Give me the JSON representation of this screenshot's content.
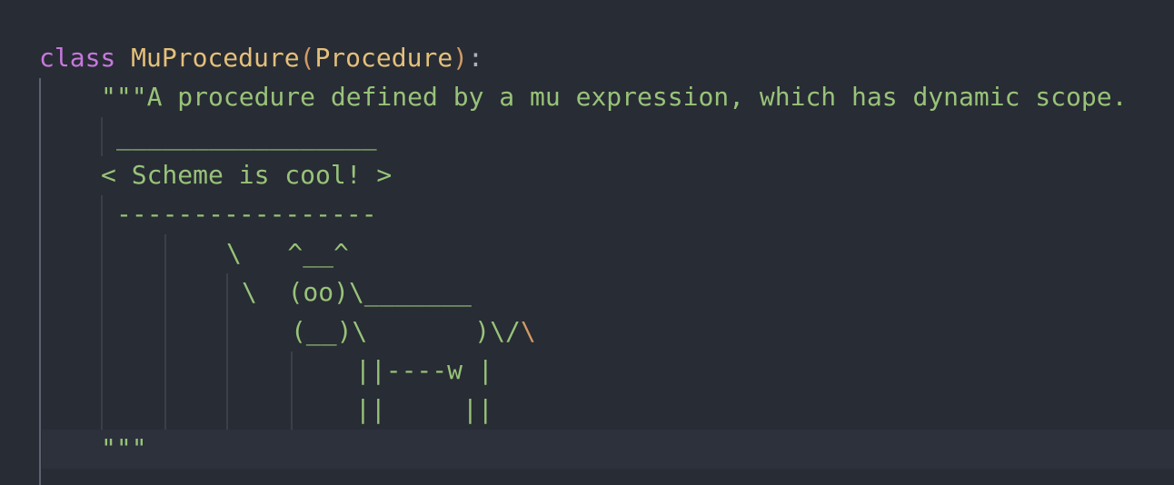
{
  "code": {
    "line1": {
      "keyword": "class",
      "class_name": "MuProcedure",
      "paren_open": "(",
      "base_class": "Procedure",
      "paren_close": ")",
      "colon": ":"
    },
    "line2": "\"\"\"A procedure defined by a mu expression, which has dynamic scope.",
    "line3": "_________________",
    "line4": "< Scheme is cool! >",
    "line5": "-----------------",
    "line6": "\\   ^__^",
    "line7": "\\  (oo)\\_______",
    "line8_a": "(__)\\       )\\/",
    "line8_b": "\\",
    "line9": "||----w |",
    "line10": "||     ||",
    "line11": "\"\"\""
  }
}
